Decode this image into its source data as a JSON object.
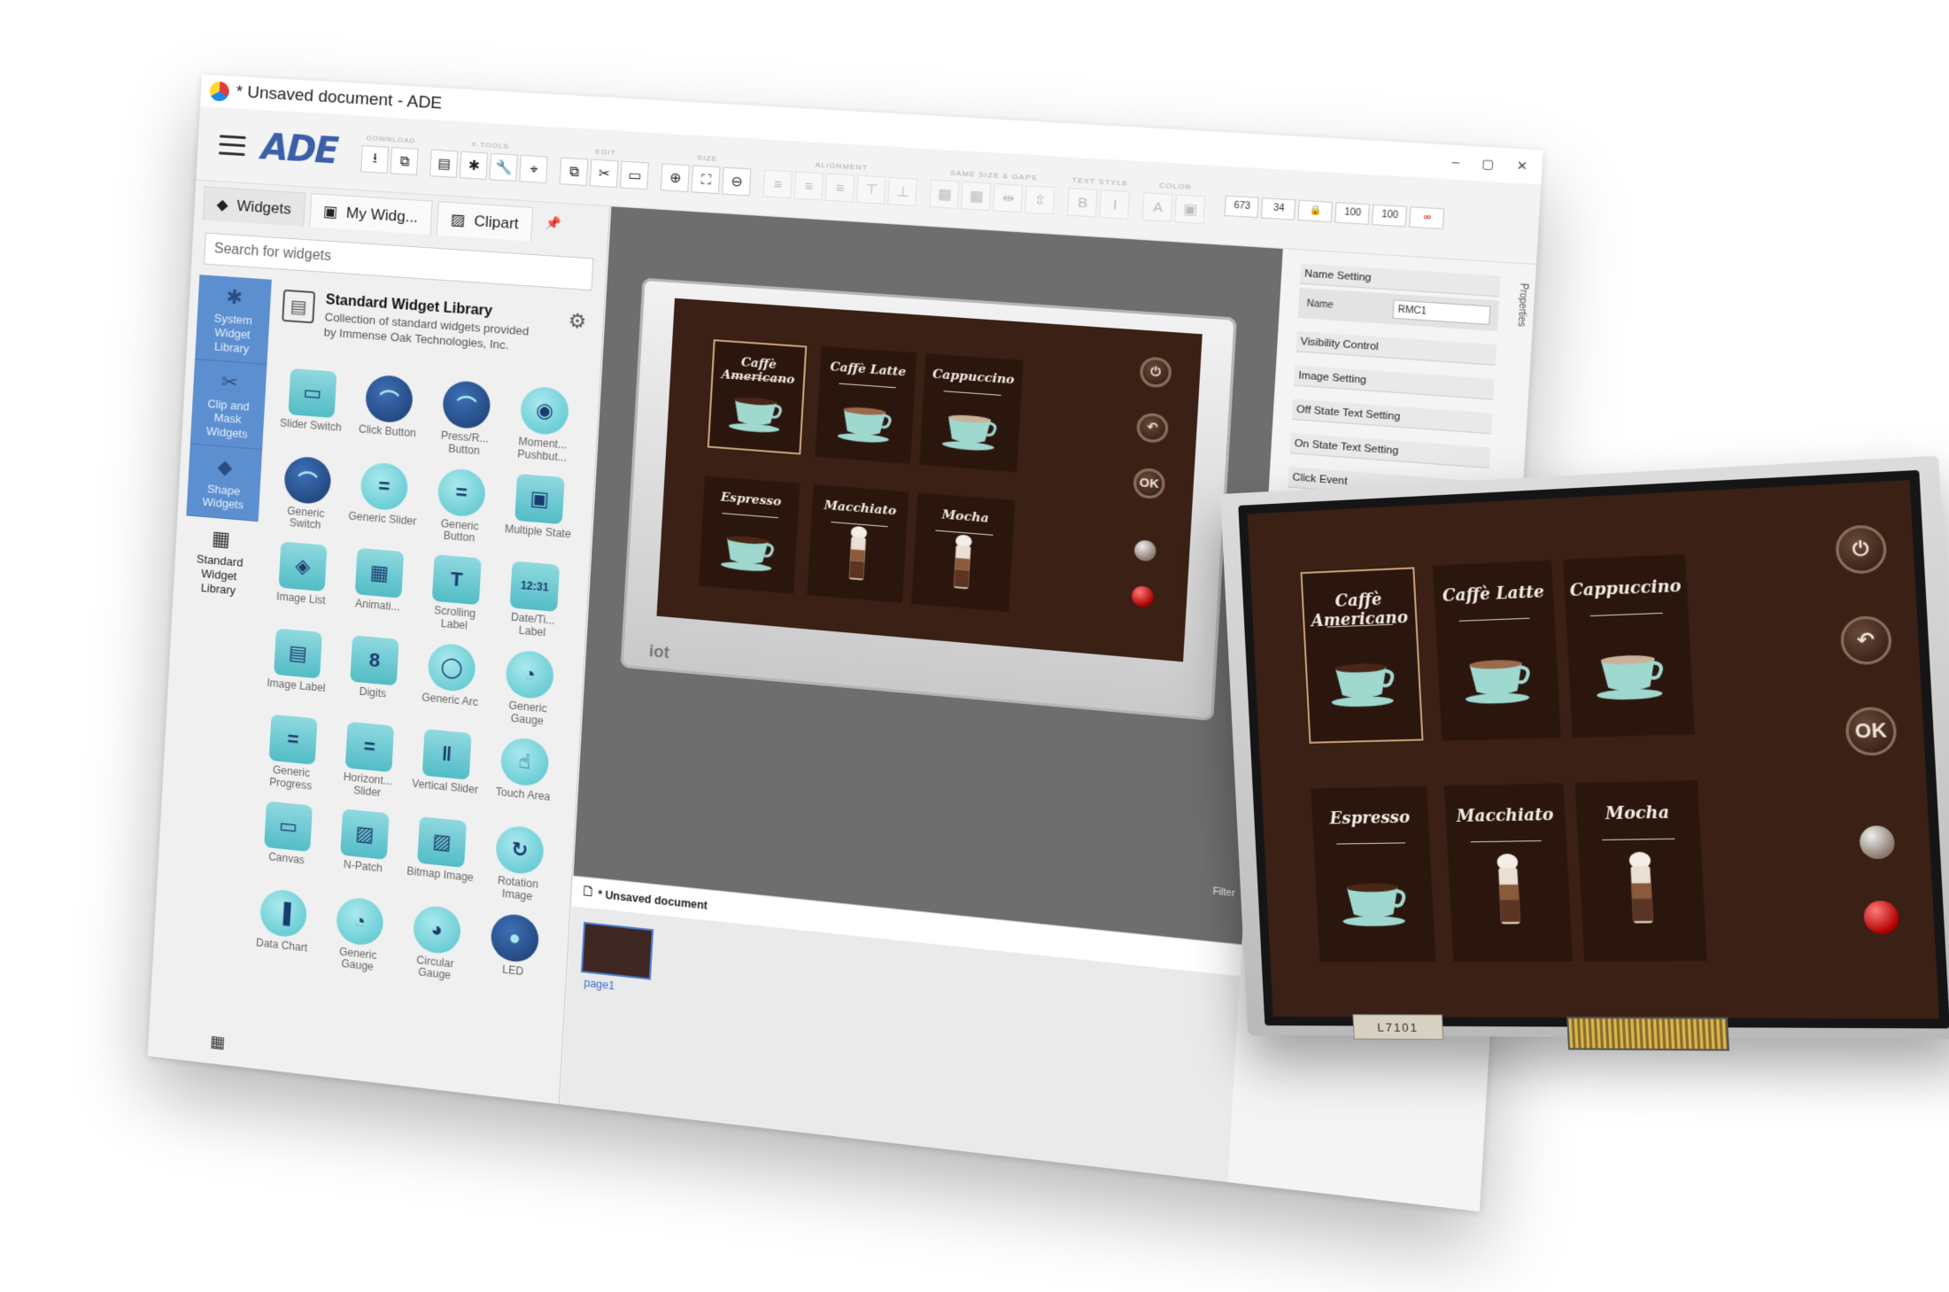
{
  "window": {
    "title": "* Unsaved document - ADE",
    "controls": [
      "–",
      "▢",
      "✕"
    ]
  },
  "toolbar": {
    "logo": "ADE",
    "groups": [
      {
        "title": "DOWNLOAD",
        "buttons": [
          "download-icon",
          "copy-icon"
        ]
      },
      {
        "title": "X-TOOLS",
        "buttons": [
          "server-icon",
          "puzzle-icon",
          "wrench-icon",
          "pin-icon"
        ]
      },
      {
        "title": "EDIT",
        "buttons": [
          "copy-icon",
          "cut-icon",
          "paste-icon"
        ]
      },
      {
        "title": "SIZE",
        "buttons": [
          "zoom-in-icon",
          "fit-icon",
          "zoom-out-icon"
        ]
      },
      {
        "title": "ALIGNMENT",
        "buttons": [
          "align-left-icon",
          "align-center-icon",
          "align-right-icon",
          "align-top-icon",
          "align-middle-icon"
        ]
      },
      {
        "title": "SAME SIZE & GAPS",
        "buttons": [
          "same-width-icon",
          "same-height-icon",
          "h-gap-icon",
          "v-gap-icon"
        ]
      },
      {
        "title": "TEXT STYLE",
        "buttons": [
          "bold-icon",
          "italic-icon"
        ]
      },
      {
        "title": "COLOR",
        "buttons": [
          "text-color-icon",
          "fill-color-icon"
        ]
      }
    ],
    "geometry_fields": [
      "673",
      "34",
      "100",
      "100"
    ]
  },
  "left_panel": {
    "tabs": [
      {
        "label": "Widgets",
        "icon": "layers-icon"
      },
      {
        "label": "My Widg...",
        "icon": "briefcase-icon"
      },
      {
        "label": "Clipart",
        "icon": "image-icon"
      }
    ],
    "search_placeholder": "Search for widgets",
    "categories": [
      {
        "label": "System Widget Library",
        "icon": "puzzle-icon"
      },
      {
        "label": "Clip and Mask Widgets",
        "icon": "scissors-icon"
      },
      {
        "label": "Shape Widgets",
        "icon": "shapes-icon"
      },
      {
        "label": "Standard Widget Library",
        "icon": "grid-icon"
      }
    ],
    "library": {
      "title": "Standard Widget Library",
      "description": "Collection of standard widgets provided by Immense Oak Technologies, Inc."
    },
    "widgets": [
      "Slider Switch",
      "Click Button",
      "Press/R... Button",
      "Moment... Pushbut...",
      "Generic Switch",
      "Generic Slider",
      "Generic Button",
      "Multiple State",
      "Image List",
      "Animati...",
      "Scrolling Label",
      "Date/Ti... Label",
      "Image Label",
      "Digits",
      "Generic Arc",
      "Generic Gauge",
      "Generic Progress",
      "Horizont... Slider",
      "Vertical Slider",
      "Touch Area",
      "Canvas",
      "N-Patch",
      "Bitmap Image",
      "Rotation Image",
      "Data Chart",
      "Generic Gauge",
      "Circular Gauge",
      "LED"
    ]
  },
  "canvas": {
    "filter_label": "Filter",
    "device_brand": "iot",
    "document_tab": "* Unsaved document",
    "page_label": "page1"
  },
  "menu": {
    "items": [
      "Caffè Americano",
      "Caffè Latte",
      "Cappuccino",
      "Espresso",
      "Macchiato",
      "Mocha"
    ],
    "buttons": [
      "⏻",
      "↶",
      "OK"
    ]
  },
  "properties": {
    "sections": [
      "Name Setting",
      "Visibility Control",
      "Image Setting",
      "Off State Text Setting",
      "On State Text Setting",
      "Click Event"
    ],
    "name_label": "Name",
    "name_value": "RMC1",
    "tab_label": "Properties"
  },
  "hardware": {
    "chip_label": "L7101"
  },
  "colors": {
    "accent_blue": "#5c8fd0",
    "screen_bg": "#3a2015",
    "card_bg": "#2b160e",
    "cup_color": "#9fd8cf"
  }
}
